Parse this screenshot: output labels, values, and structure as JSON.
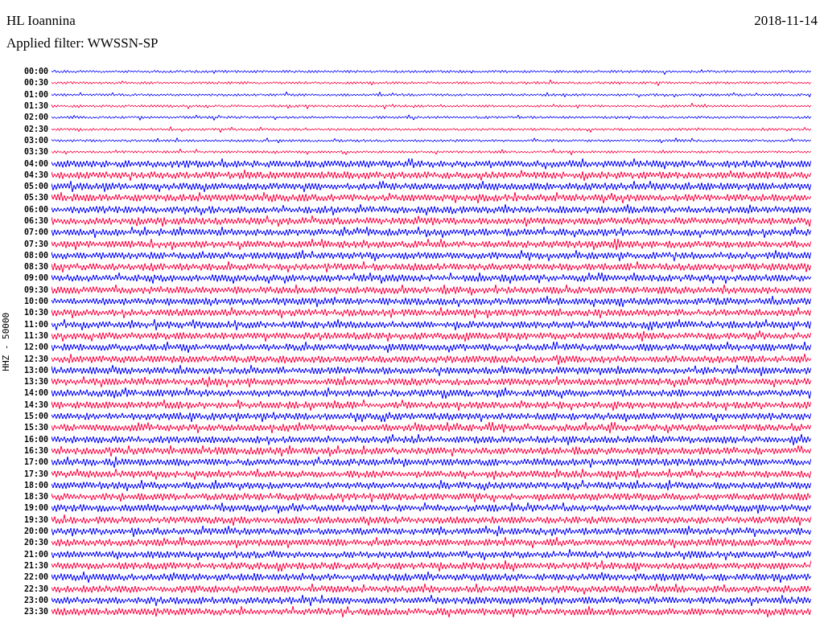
{
  "header": {
    "station": "HL Ioannina",
    "filter": "Applied filter: WWSSN-SP",
    "date": "2018-11-14"
  },
  "axis_label": "HHZ - 50000",
  "rows": [
    {
      "time": "00:00",
      "color": "#0000ff"
    },
    {
      "time": "00:30",
      "color": "#ff0040"
    },
    {
      "time": "01:00",
      "color": "#0000ff"
    },
    {
      "time": "01:30",
      "color": "#ff0040"
    },
    {
      "time": "02:00",
      "color": "#0000ff"
    },
    {
      "time": "02:30",
      "color": "#ff0040"
    },
    {
      "time": "03:00",
      "color": "#0000ff"
    },
    {
      "time": "03:30",
      "color": "#ff0040"
    },
    {
      "time": "04:00",
      "color": "#0000ff"
    },
    {
      "time": "04:30",
      "color": "#ff0040"
    },
    {
      "time": "05:00",
      "color": "#0000ff"
    },
    {
      "time": "05:30",
      "color": "#ff0040"
    },
    {
      "time": "06:00",
      "color": "#0000ff"
    },
    {
      "time": "06:30",
      "color": "#ff0040"
    },
    {
      "time": "07:00",
      "color": "#0000ff"
    },
    {
      "time": "07:30",
      "color": "#ff0040"
    },
    {
      "time": "08:00",
      "color": "#0000ff"
    },
    {
      "time": "08:30",
      "color": "#ff0040"
    },
    {
      "time": "09:00",
      "color": "#0000ff"
    },
    {
      "time": "09:30",
      "color": "#ff0040"
    },
    {
      "time": "10:00",
      "color": "#0000ff"
    },
    {
      "time": "10:30",
      "color": "#ff0040"
    },
    {
      "time": "11:00",
      "color": "#0000ff"
    },
    {
      "time": "11:30",
      "color": "#ff0040"
    },
    {
      "time": "12:00",
      "color": "#0000ff"
    },
    {
      "time": "12:30",
      "color": "#ff0040"
    },
    {
      "time": "13:00",
      "color": "#0000ff"
    },
    {
      "time": "13:30",
      "color": "#ff0040"
    },
    {
      "time": "14:00",
      "color": "#0000ff"
    },
    {
      "time": "14:30",
      "color": "#ff0040"
    },
    {
      "time": "15:00",
      "color": "#0000ff"
    },
    {
      "time": "15:30",
      "color": "#ff0040"
    },
    {
      "time": "16:00",
      "color": "#0000ff"
    },
    {
      "time": "16:30",
      "color": "#ff0040"
    },
    {
      "time": "17:00",
      "color": "#0000ff"
    },
    {
      "time": "17:30",
      "color": "#ff0040"
    },
    {
      "time": "18:00",
      "color": "#0000ff"
    },
    {
      "time": "18:30",
      "color": "#ff0040"
    },
    {
      "time": "19:00",
      "color": "#0000ff"
    },
    {
      "time": "19:30",
      "color": "#ff0040"
    },
    {
      "time": "20:00",
      "color": "#0000ff"
    },
    {
      "time": "20:30",
      "color": "#ff0040"
    },
    {
      "time": "21:00",
      "color": "#0000ff"
    },
    {
      "time": "21:30",
      "color": "#ff0040"
    },
    {
      "time": "22:00",
      "color": "#0000ff"
    },
    {
      "time": "22:30",
      "color": "#ff0040"
    },
    {
      "time": "23:00",
      "color": "#0000ff"
    },
    {
      "time": "23:30",
      "color": "#ff0040"
    }
  ]
}
